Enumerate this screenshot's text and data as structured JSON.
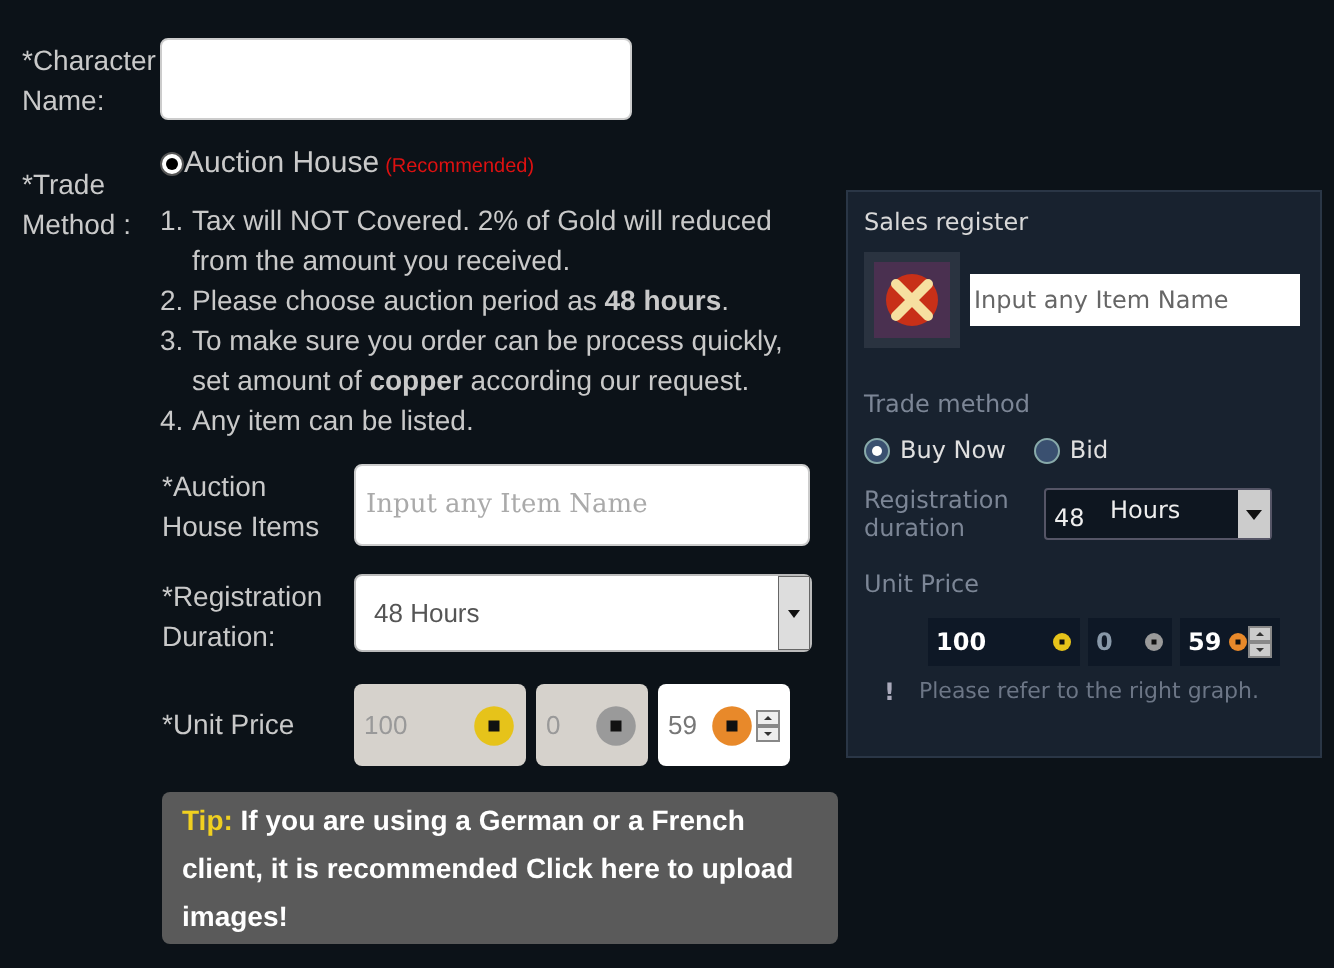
{
  "character_name": {
    "label": "*Character Name:"
  },
  "trade_method": {
    "label": "*Trade Method :",
    "options": [
      {
        "label": "Auction House",
        "note": "(Recommended)",
        "selected": true
      }
    ],
    "instructions": [
      {
        "number": "1.",
        "text": "Tax will NOT Covered. 2% of Gold will reduced from the amount you received."
      },
      {
        "number": "2.",
        "text": "Please choose auction period as **48 hours**."
      },
      {
        "number": "3.",
        "text": "To make sure you order can be process quickly, set amount of **copper** according our request."
      },
      {
        "number": "4.",
        "text": "Any item can be listed."
      }
    ]
  },
  "auction_items": {
    "label": "*Auction House Items",
    "placeholder": "Input any Item Name"
  },
  "registration": {
    "label": "*Registration Duration:",
    "value": "48 Hours"
  },
  "unit_price": {
    "label": "*Unit Price",
    "fields": [
      {
        "kind": "gold",
        "value": "100",
        "disabled": true
      },
      {
        "kind": "silver",
        "value": "0",
        "disabled": true
      },
      {
        "kind": "copper",
        "value": "59",
        "disabled": false
      }
    ]
  },
  "tip": {
    "label": "Tip:",
    "text": "If you are using a German or a French client, it is recommended Click here to upload images!"
  },
  "sales_register": {
    "title": "Sales register",
    "item_placeholder": "Input any Item Name",
    "trade_method_label": "Trade method",
    "options": [
      {
        "label": "Buy Now",
        "selected": true
      },
      {
        "label": "Bid",
        "selected": false
      }
    ],
    "duration_label": "Registration duration",
    "duration_value": "48",
    "duration_unit": "Hours",
    "unit_price_label": "Unit Price",
    "fields": [
      {
        "kind": "gold",
        "value": "100"
      },
      {
        "kind": "silver",
        "value": "0"
      },
      {
        "kind": "copper",
        "value": "59"
      }
    ],
    "note_icon": "!",
    "note": "Please refer to the right graph."
  }
}
